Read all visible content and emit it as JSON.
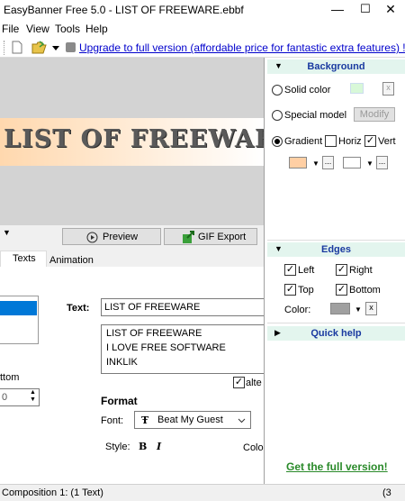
{
  "window": {
    "title": "EasyBanner Free 5.0 - LIST OF FREEWARE.ebbf",
    "minimize": "—",
    "maximize": "☐",
    "close": "✕"
  },
  "menu": {
    "file": "File",
    "view": "View",
    "tools": "Tools",
    "help": "Help"
  },
  "toolbar": {
    "upgrade_link": "Upgrade to full version (affordable price for fantastic extra features) !"
  },
  "banner": {
    "text": "LIST OF FREEWARE"
  },
  "background": {
    "header": "Background",
    "solid_color": "Solid color",
    "special_model": "Special model",
    "modify": "Modify",
    "gradient": "Gradient",
    "horiz": "Horiz",
    "vert": "Vert",
    "selected_mode": "Gradient",
    "color1": "#ffcfa4",
    "color2": "#ffffff",
    "solid_swatch": "#d8f8d8",
    "x_label": "x",
    "ellipsis": "..."
  },
  "edges": {
    "header": "Edges",
    "left": "Left",
    "right": "Right",
    "top": "Top",
    "bottom": "Bottom",
    "color_label": "Color:",
    "color": "#a0a0a0",
    "x_label": "x"
  },
  "quickhelp": {
    "header": "Quick help"
  },
  "get_full": "Get the full version!",
  "actions": {
    "preview": "Preview",
    "gif_export": "GIF Export"
  },
  "tabs": {
    "texts": "Texts",
    "animation": "Animation"
  },
  "text_panel": {
    "text_label": "Text:",
    "text_value": "LIST OF FREEWARE",
    "list": [
      "LIST OF FREEWARE",
      "I LOVE FREE SOFTWARE",
      "INKLIK"
    ],
    "partial_label": "ttom",
    "spin_value": "0",
    "alt_label": "alte",
    "format_heading": "Format",
    "font_label": "Font:",
    "font_value": "Beat My Guest",
    "style_label": "Style:",
    "bold": "B",
    "italic": "I",
    "color_label_partial": "Colo"
  },
  "status": {
    "composition": "Composition 1:  (1 Text)",
    "right": "(3"
  }
}
